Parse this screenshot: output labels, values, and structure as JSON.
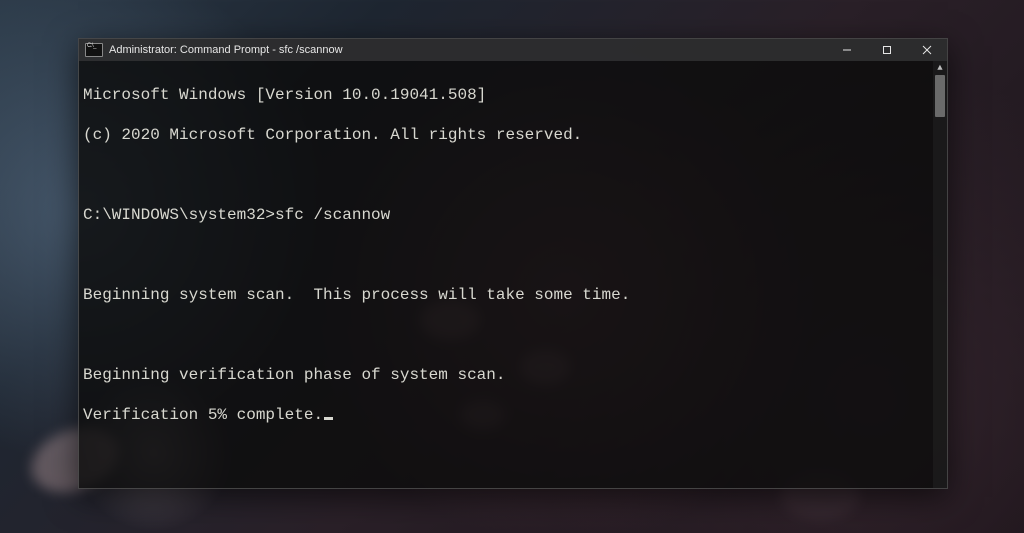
{
  "window": {
    "title": "Administrator: Command Prompt - sfc  /scannow"
  },
  "terminal": {
    "version_line": "Microsoft Windows [Version 10.0.19041.508]",
    "copyright_line": "(c) 2020 Microsoft Corporation. All rights reserved.",
    "prompt": "C:\\WINDOWS\\system32>",
    "command": "sfc /scannow",
    "begin_scan": "Beginning system scan.  This process will take some time.",
    "begin_verify": "Beginning verification phase of system scan.",
    "progress_line": "Verification 5% complete."
  }
}
